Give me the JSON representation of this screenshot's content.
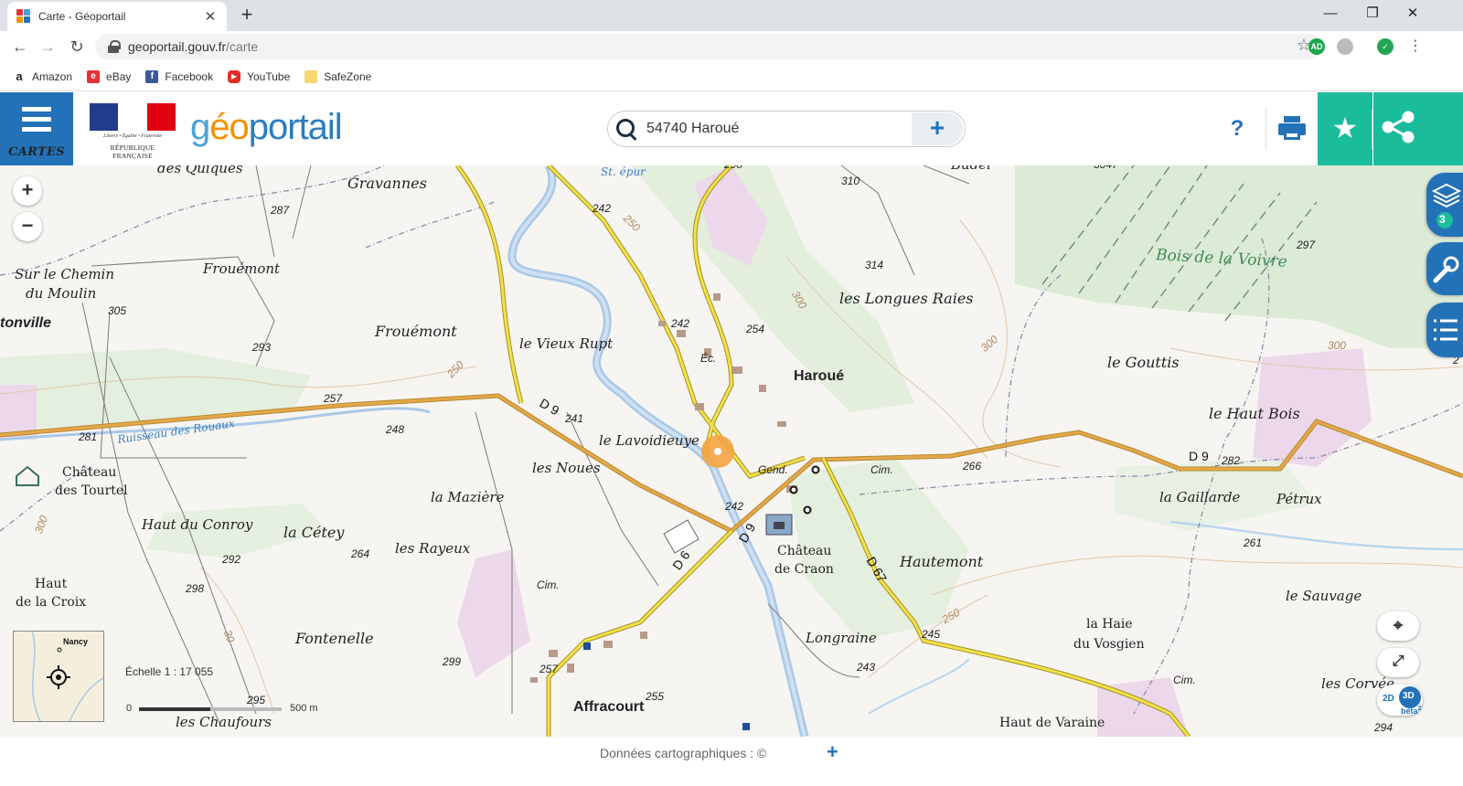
{
  "browser": {
    "tab_title": "Carte - Géoportail",
    "url_host": "geoportail.gouv.fr",
    "url_path": "/carte",
    "bookmarks": [
      {
        "label": "Amazon",
        "color": "#222222",
        "glyph": "a"
      },
      {
        "label": "eBay",
        "color": "#e53238",
        "glyph": "e"
      },
      {
        "label": "Facebook",
        "color": "#3b5998",
        "glyph": "f"
      },
      {
        "label": "YouTube",
        "color": "#e52d27",
        "glyph": "▶"
      },
      {
        "label": "SafeZone",
        "color": "#f7d774",
        "glyph": ""
      }
    ],
    "extension_badge": "AD"
  },
  "header": {
    "menu_label": "CARTES",
    "republic_motto": "Liberté • Égalité • Fraternité",
    "republic_name": "RÉPUBLIQUE FRANÇAISE",
    "logo_g": "g",
    "logo_eo": "éo",
    "logo_rest": "portail",
    "search_value": "54740 Haroué",
    "help_label": "?",
    "accent_color": "#2372b8",
    "share_color": "#1abc9c"
  },
  "map": {
    "layers_count": "3",
    "view_2d": "2D",
    "view_3d": "3D",
    "beta": "béta",
    "beta_sup": "2",
    "overview_city": "Nancy",
    "scale_label": "Échelle 1 : 17 055",
    "scale_zero": "0",
    "scale_max": "500 m",
    "places": {
      "des_quiques": "des Quiques",
      "gravannes": "Gravannes",
      "sur_le_chemin": "Sur le Chemin",
      "du_moulin": "du Moulin",
      "tonville": "tonville",
      "frouemont1": "Frouémont",
      "frouemont2": "Frouémont",
      "vieux_rupt": "le Vieux Rupt",
      "st_epur": "St. épur",
      "haroue": "Haroué",
      "longues_raies": "les Longues Raies",
      "bois_voivre": "Bois de la Voivre",
      "gouttis": "le Gouttis",
      "haut_bois": "le Haut Bois",
      "budel": "Budel",
      "ruisseau": "Ruisseau des Rouaux",
      "chateau_tourtel_1": "Château",
      "chateau_tourtel_2": "des Tourtel",
      "lavoidieuye": "le Lavoidieuye",
      "les_noues": "les Noues",
      "la_maziere": "la Mazière",
      "haut_conroy": "Haut du Conroy",
      "la_cetey": "la Cétey",
      "les_rayeux": "les Rayeux",
      "haut_croix_1": "Haut",
      "haut_croix_2": "de la Croix",
      "fontenelle": "Fontenelle",
      "chaufours": "les Chaufours",
      "affracourt": "Affracourt",
      "chateau_craon_1": "Château",
      "chateau_craon_2": "de Craon",
      "hautemont": "Hautemont",
      "longraine": "Longraine",
      "la_gaillarde": "la Gaillarde",
      "petrux": "Pétrux",
      "le_sauvage": "le Sauvage",
      "haie_vosgien_1": "la Haie",
      "haie_vosgien_2": "du Vosgien",
      "les_corvees": "les Corvée",
      "haut_varaine": "Haut de Varaine",
      "gend": "Gend.",
      "cim1": "Cim.",
      "cim2": "Cim.",
      "cim3": "Cim.",
      "ec": "Éc."
    },
    "roads": {
      "d9_west": "D 9",
      "d9_east": "D 9",
      "d9_center": "D 9",
      "d6": "D 6",
      "d67": "D 67"
    },
    "altitudes": {
      "a298": "298",
      "a310": "310",
      "a3047": "3047",
      "a297": "297",
      "a287": "287",
      "a314": "314",
      "a242a": "242",
      "a250a": "250",
      "a305": "305",
      "a293": "293",
      "a242b": "242",
      "a254": "254",
      "a300a": "300",
      "a300b": "300",
      "a300c": "300",
      "a257a": "257",
      "a241": "241",
      "a248": "248",
      "a281": "281",
      "a250b": "250",
      "a266": "266",
      "a282": "282",
      "a242c": "242",
      "a264": "264",
      "a292": "292",
      "a298b": "298",
      "a261": "261",
      "a250c": "250",
      "a245": "245",
      "a243": "243",
      "a299": "299",
      "a257b": "257",
      "a255": "255",
      "a295": "295",
      "a294": "294",
      "a300d": "300",
      "a30": "30",
      "a2": "2"
    }
  },
  "footer": {
    "credits": "Données cartographiques : ©",
    "plus": "+"
  }
}
